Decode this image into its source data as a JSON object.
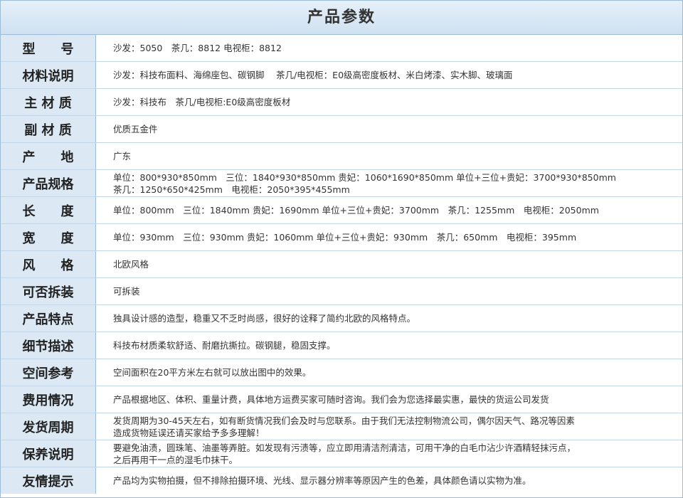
{
  "title": "产品参数",
  "rows": [
    {
      "label": "型　　号",
      "lines": [
        "沙发：5050　茶几：8812 电视柜：8812"
      ]
    },
    {
      "label": "材料说明",
      "lines": [
        "沙发：科技布面料、海绵座包、碳钢脚　 茶几/电视柜：E0级高密度板材、米白烤漆、实木脚、玻璃面"
      ]
    },
    {
      "label": "主 材 质",
      "lines": [
        "沙发：科技布　茶几/电视柜:E0级高密度板材"
      ]
    },
    {
      "label": "副 材 质",
      "lines": [
        "优质五金件"
      ]
    },
    {
      "label": "产　　地",
      "lines": [
        "广东"
      ]
    },
    {
      "label": "产品规格",
      "lines": [
        "单位：800*930*850mm　三位：1840*930*850mm 贵妃：1060*1690*850mm 单位+三位+贵妃：3700*930*850mm",
        "茶几：1250*650*425mm　电视柜：2050*395*455mm"
      ]
    },
    {
      "label": "长　　度",
      "lines": [
        "单位：800mm　三位：1840mm 贵妃：1690mm 单位+三位+贵妃：3700mm　茶几：1255mm　电视柜：2050mm"
      ]
    },
    {
      "label": "宽　　度",
      "lines": [
        "单位：930mm　三位：930mm 贵妃：1060mm 单位+三位+贵妃：930mm　茶几：650mm　电视柜：395mm"
      ]
    },
    {
      "label": "风　　格",
      "lines": [
        "北欧风格"
      ]
    },
    {
      "label": "可否拆装",
      "lines": [
        "可拆装"
      ]
    },
    {
      "label": "产品特点",
      "lines": [
        "独具设计感的造型，稳重又不乏时尚感，很好的诠释了简约北欧的风格特点。"
      ]
    },
    {
      "label": "细节描述",
      "lines": [
        "科技布材质柔软舒适、耐磨抗撕拉。碳钢腿，稳固支撑。"
      ]
    },
    {
      "label": "空间参考",
      "lines": [
        "空间面积在20平方米左右就可以放出图中的效果。"
      ]
    },
    {
      "label": "费用情况",
      "lines": [
        "产品根据地区、体积、重量计费，具体地方运费买家可随时咨询。我们会为您选择最实惠，最快的货运公司发货"
      ]
    },
    {
      "label": "发货周期",
      "lines": [
        "发货周期为30-45天左右，如有断货情况我们会及时与您联系。由于我们无法控制物流公司，偶尔因天气、路况等因素",
        "造成货物延误还请买家给予多多理解！"
      ]
    },
    {
      "label": "保养说明",
      "lines": [
        "要避免油渍，圆珠笔、油墨等弄脏。如发现有污渍等，应立即用清洁剂清洁，可用干净的白毛巾沾少许酒精轻抹污点，",
        "之后再用干一点的湿毛巾抹干。"
      ]
    },
    {
      "label": "友情提示",
      "lines": [
        "产品均为实物拍摄，但不排除拍摄环境、光线、显示器分辨率等原因产生的色差，具体颜色请以实物为准。"
      ]
    }
  ]
}
